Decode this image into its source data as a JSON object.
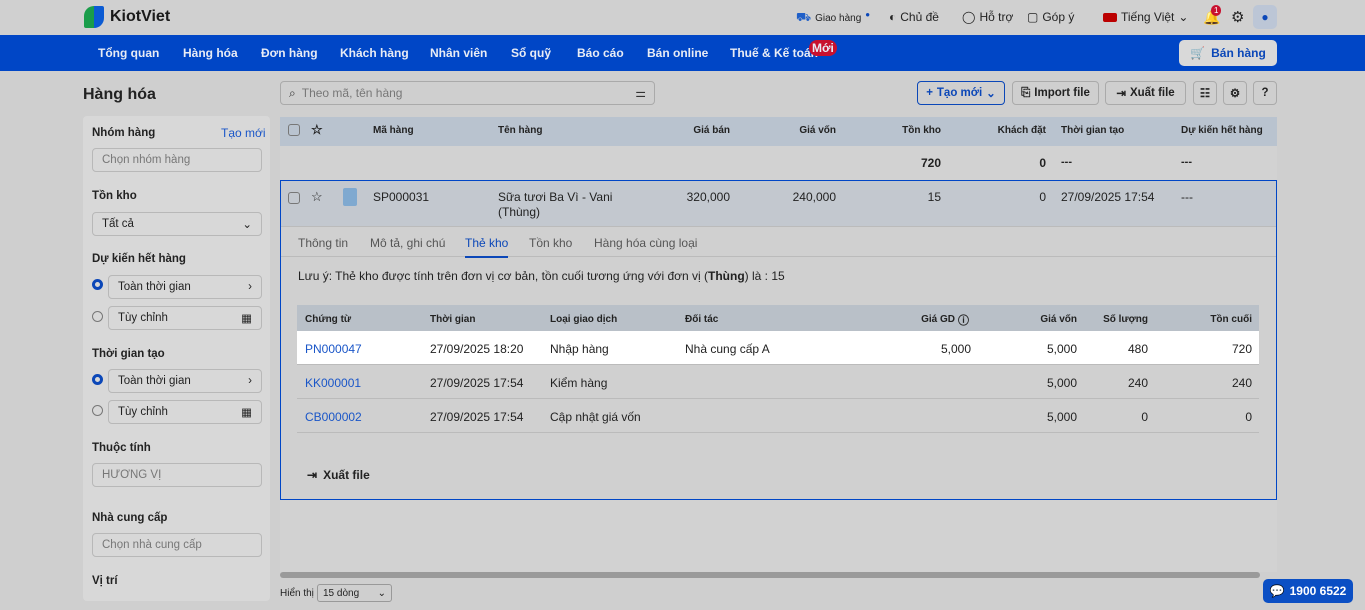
{
  "app": {
    "name": "KiotViet"
  },
  "topbar": {
    "delivery": "Giao hàng",
    "theme": "Chủ đề",
    "support": "Hỗ trợ",
    "feedback": "Góp ý",
    "language": "Tiếng Việt",
    "notif_count": "1"
  },
  "nav": {
    "items": [
      "Tổng quan",
      "Hàng hóa",
      "Đơn hàng",
      "Khách hàng",
      "Nhân viên",
      "Sổ quỹ",
      "Báo cáo",
      "Bán online",
      "Thuế & Kế toán"
    ],
    "new_badge": "Mới",
    "sell": "Bán hàng"
  },
  "page": {
    "title": "Hàng hóa"
  },
  "sidebar": {
    "group_label": "Nhóm hàng",
    "group_create": "Tạo mới",
    "group_placeholder": "Chọn nhóm hàng",
    "stock_label": "Tồn kho",
    "stock_value": "Tất cả",
    "expiry_label": "Dự kiến hết hàng",
    "expiry_all": "Toàn thời gian",
    "expiry_custom": "Tùy chỉnh",
    "created_label": "Thời gian tạo",
    "created_all": "Toàn thời gian",
    "created_custom": "Tùy chỉnh",
    "attr_label": "Thuộc tính",
    "attr_placeholder": "HƯƠNG VỊ",
    "supplier_label": "Nhà cung cấp",
    "supplier_placeholder": "Chọn nhà cung cấp",
    "location_label": "Vị trí"
  },
  "toolbar": {
    "search_placeholder": "Theo mã, tên hàng",
    "create": "Tạo mới",
    "import": "Import file",
    "export": "Xuất file"
  },
  "table": {
    "headers": [
      "Mã hàng",
      "Tên hàng",
      "Giá bán",
      "Giá vốn",
      "Tồn kho",
      "Khách đặt",
      "Thời gian tạo",
      "Dự kiến hết hàng"
    ],
    "summary": {
      "stock": "720",
      "ordered": "0",
      "created": "---",
      "expiry": "---"
    },
    "product": {
      "code": "SP000031",
      "name_line1": "Sữa tươi Ba Vì - Vani",
      "name_line2": "(Thùng)",
      "price": "320,000",
      "cost": "240,000",
      "stock": "15",
      "ordered": "0",
      "created": "27/09/2025 17:54",
      "expiry": "---"
    }
  },
  "detail": {
    "tabs": [
      "Thông tin",
      "Mô tả, ghi chú",
      "Thẻ kho",
      "Tồn kho",
      "Hàng hóa cùng loại"
    ],
    "note_prefix": "Lưu ý: Thẻ kho được tính trên đơn vị cơ bản, tồn cuối tương ứng với đơn vị (",
    "note_unit": "Thùng",
    "note_suffix": ") là : 15",
    "headers": [
      "Chứng từ",
      "Thời gian",
      "Loại giao dịch",
      "Đối tác",
      "Giá GD",
      "Giá vốn",
      "Số lượng",
      "Tồn cuối"
    ],
    "rows": [
      {
        "doc": "PN000047",
        "time": "27/09/2025 18:20",
        "type": "Nhập hàng",
        "partner": "Nhà cung cấp A",
        "price": "5,000",
        "cost": "5,000",
        "qty": "480",
        "end": "720"
      },
      {
        "doc": "KK000001",
        "time": "27/09/2025 17:54",
        "type": "Kiểm hàng",
        "partner": "",
        "price": "",
        "cost": "5,000",
        "qty": "240",
        "end": "240"
      },
      {
        "doc": "CB000002",
        "time": "27/09/2025 17:54",
        "type": "Cập nhật giá vốn",
        "partner": "",
        "price": "",
        "cost": "5,000",
        "qty": "0",
        "end": "0"
      }
    ],
    "export": "Xuất file"
  },
  "footer": {
    "show_label": "Hiển thị",
    "page_size": "15 dòng",
    "hotline": "1900 6522"
  }
}
